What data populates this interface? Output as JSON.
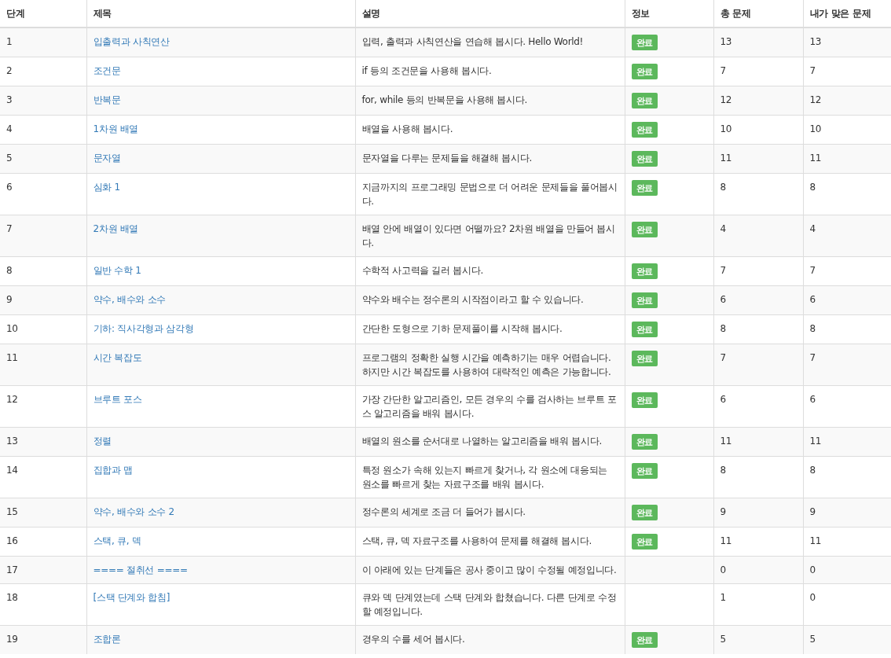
{
  "table": {
    "columns": [
      "단계",
      "제목",
      "설명",
      "정보",
      "총 문제",
      "내가 맞은 문제"
    ],
    "rows": [
      {
        "step": "1",
        "title": "입출력과 사칙연산",
        "description": "입력, 출력과 사칙연산을 연습해 봅시다. Hello World!",
        "badge": "완료",
        "total": "13",
        "solved": "13"
      },
      {
        "step": "2",
        "title": "조건문",
        "description": "if 등의 조건문을 사용해 봅시다.",
        "badge": "완료",
        "total": "7",
        "solved": "7"
      },
      {
        "step": "3",
        "title": "반복문",
        "description": "for, while 등의 반복문을 사용해 봅시다.",
        "badge": "완료",
        "total": "12",
        "solved": "12"
      },
      {
        "step": "4",
        "title": "1차원 배열",
        "description": "배열을 사용해 봅시다.",
        "badge": "완료",
        "total": "10",
        "solved": "10"
      },
      {
        "step": "5",
        "title": "문자열",
        "description": "문자열을 다루는 문제들을 해결해 봅시다.",
        "badge": "완료",
        "total": "11",
        "solved": "11"
      },
      {
        "step": "6",
        "title": "심화 1",
        "description": "지금까지의 프로그래밍 문법으로 더 어려운 문제들을 풀어봅시다.",
        "badge": "완료",
        "total": "8",
        "solved": "8"
      },
      {
        "step": "7",
        "title": "2차원 배열",
        "description": "배열 안에 배열이 있다면 어떨까요? 2차원 배열을 만들어 봅시다.",
        "badge": "완료",
        "total": "4",
        "solved": "4"
      },
      {
        "step": "8",
        "title": "일반 수학 1",
        "description": "수학적 사고력을 길러 봅시다.",
        "badge": "완료",
        "total": "7",
        "solved": "7"
      },
      {
        "step": "9",
        "title": "약수, 배수와 소수",
        "description": "약수와 배수는 정수론의 시작점이라고 할 수 있습니다.",
        "badge": "완료",
        "total": "6",
        "solved": "6"
      },
      {
        "step": "10",
        "title": "기하: 직사각형과 삼각형",
        "description": "간단한 도형으로 기하 문제풀이를 시작해 봅시다.",
        "badge": "완료",
        "total": "8",
        "solved": "8"
      },
      {
        "step": "11",
        "title": "시간 복잡도",
        "description": "프로그램의 정확한 실행 시간을 예측하기는 매우 어렵습니다. 하지만 시간 복잡도를 사용하여 대략적인 예측은 가능합니다.",
        "badge": "완료",
        "total": "7",
        "solved": "7"
      },
      {
        "step": "12",
        "title": "브루트 포스",
        "description": "가장 간단한 알고리즘인, 모든 경우의 수를 검사하는 브루트 포스 알고리즘을 배워 봅시다.",
        "badge": "완료",
        "total": "6",
        "solved": "6"
      },
      {
        "step": "13",
        "title": "정렬",
        "description": "배열의 원소를 순서대로 나열하는 알고리즘을 배워 봅시다.",
        "badge": "완료",
        "total": "11",
        "solved": "11"
      },
      {
        "step": "14",
        "title": "집합과 맵",
        "description": "특정 원소가 속해 있는지 빠르게 찾거나, 각 원소에 대응되는 원소를 빠르게 찾는 자료구조를 배워 봅시다.",
        "badge": "완료",
        "total": "8",
        "solved": "8"
      },
      {
        "step": "15",
        "title": "약수, 배수와 소수 2",
        "description": "정수론의 세계로 조금 더 들어가 봅시다.",
        "badge": "완료",
        "total": "9",
        "solved": "9"
      },
      {
        "step": "16",
        "title": "스택, 큐, 덱",
        "description": "스택, 큐, 덱 자료구조를 사용하여 문제를 해결해 봅시다.",
        "badge": "완료",
        "total": "11",
        "solved": "11"
      },
      {
        "step": "17",
        "title": "==== 절취선 ====",
        "description": "이 아래에 있는 단계들은 공사 중이고 많이 수정될 예정입니다.",
        "total": "0",
        "solved": "0"
      },
      {
        "step": "18",
        "title": "[스택 단계와 합침]",
        "description": "큐와 덱 단계였는데 스택 단계와 합쳤습니다. 다른 단계로 수정할 예정입니다.",
        "total": "1",
        "solved": "0"
      },
      {
        "step": "19",
        "title": "조합론",
        "description": "경우의 수를 세어 봅시다.",
        "badge": "완료",
        "total": "5",
        "solved": "5"
      }
    ]
  }
}
